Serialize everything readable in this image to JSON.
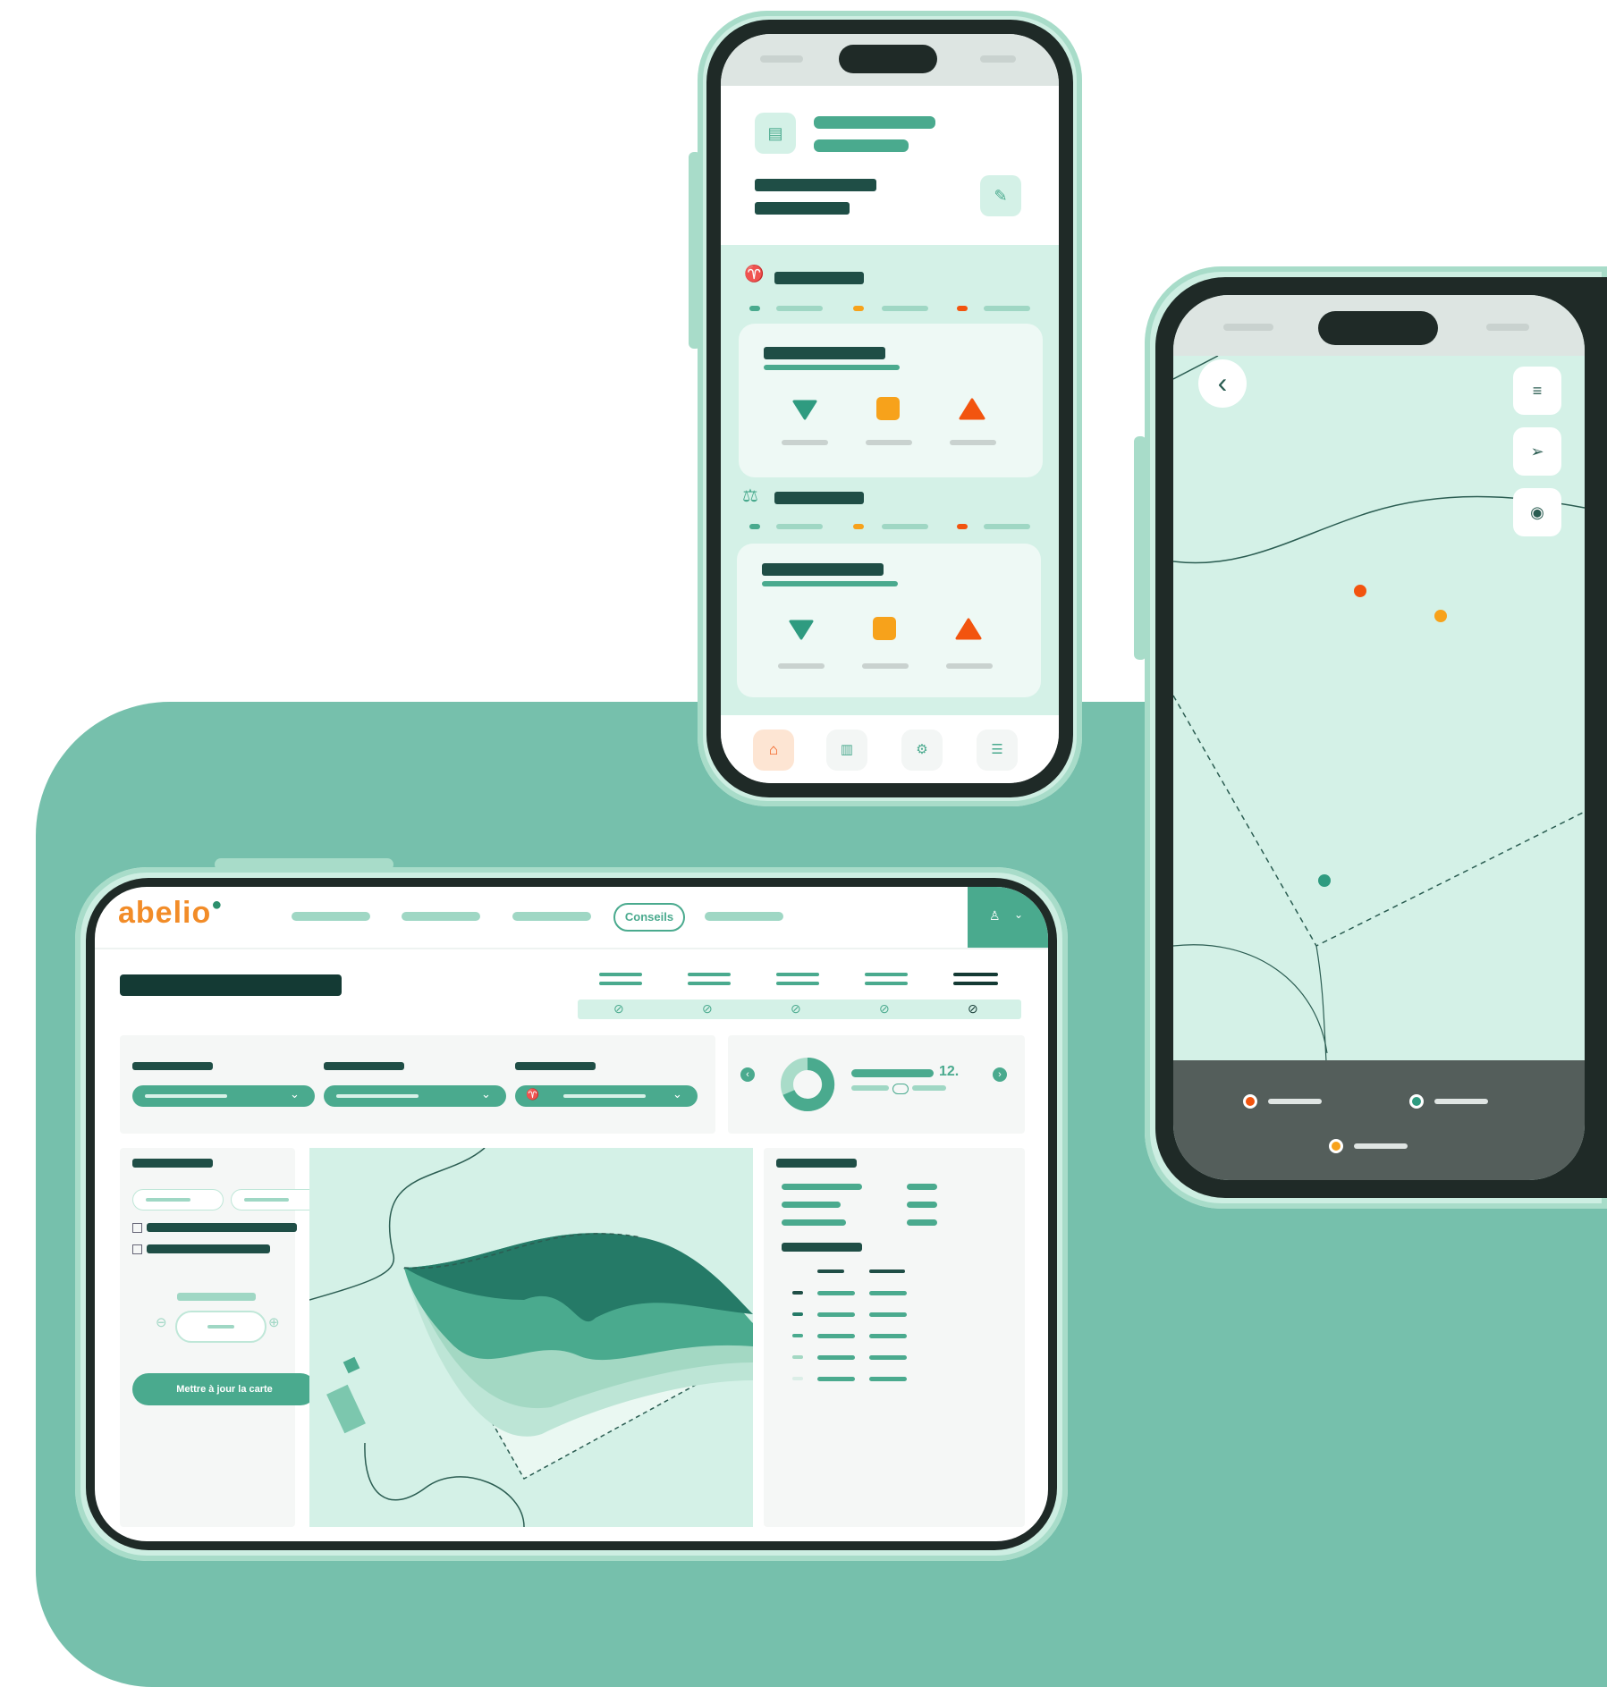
{
  "brand": {
    "logo_text": "abelio",
    "logo_color": "#f28c28",
    "primary": "#4aaa8e",
    "dark": "#1f4e46",
    "light": "#d4f1e7",
    "accent_orange": "#f7a21b",
    "accent_red": "#f2540f"
  },
  "tablet": {
    "nav": {
      "active_tab_label": "Conseils"
    },
    "sidebar": {
      "update_button_label": "Mettre à jour la carte"
    },
    "stats": {
      "value_label": "12."
    }
  },
  "phone_dashboard": {
    "bottom_nav": [
      "home",
      "map",
      "tractor",
      "list"
    ]
  },
  "phone_map": {
    "legend": [
      "red",
      "teal",
      "orange"
    ]
  }
}
